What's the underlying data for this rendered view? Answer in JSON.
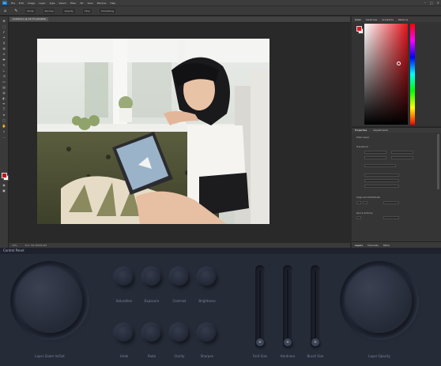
{
  "menubar": {
    "app": "Ps",
    "items": [
      "File",
      "Edit",
      "Image",
      "Layer",
      "Type",
      "Select",
      "Filter",
      "3D",
      "View",
      "Window",
      "Help"
    ]
  },
  "options": {
    "items": [
      "Mode",
      "Normal",
      "Opacity",
      "Flow",
      "Smoothing"
    ]
  },
  "document": {
    "tab": "Untitled-1 @ 16.7% (RGB/8)",
    "zoom": "16%",
    "doc_info": "Doc: 56.2M/56.2M"
  },
  "panels": {
    "top_tabs": [
      "Color",
      "Swatches",
      "Gradients",
      "Patterns"
    ],
    "prop_tabs": [
      "Properties",
      "Adjustments"
    ],
    "prop_layer": "Pixel Layer",
    "transform_label": "Transform",
    "align_label": "Align and Distribute",
    "quick_label": "Quick Actions",
    "layer_tabs": [
      "Layers",
      "Channels",
      "Paths"
    ],
    "colors": {
      "fg": "#e4121b",
      "bg": "#ffffff",
      "hue": "#e3141c"
    }
  },
  "console": {
    "title": "Control Panel",
    "left_dial_label": "Layer Zoom In/Out",
    "right_dial_label": "Layer Opacity",
    "knobs_top": [
      "Saturation",
      "Exposure",
      "Contrast",
      "Brightness"
    ],
    "knobs_bottom": [
      "Undo",
      "Redo",
      "Clarity",
      "Sharpen"
    ],
    "sliders": [
      {
        "label": "Font Size",
        "level": 0.0,
        "icon": "+"
      },
      {
        "label": "Hardness",
        "level": 0.0,
        "icon": "+"
      },
      {
        "label": "Brush Size",
        "level": 0.0,
        "icon": "+"
      }
    ]
  }
}
